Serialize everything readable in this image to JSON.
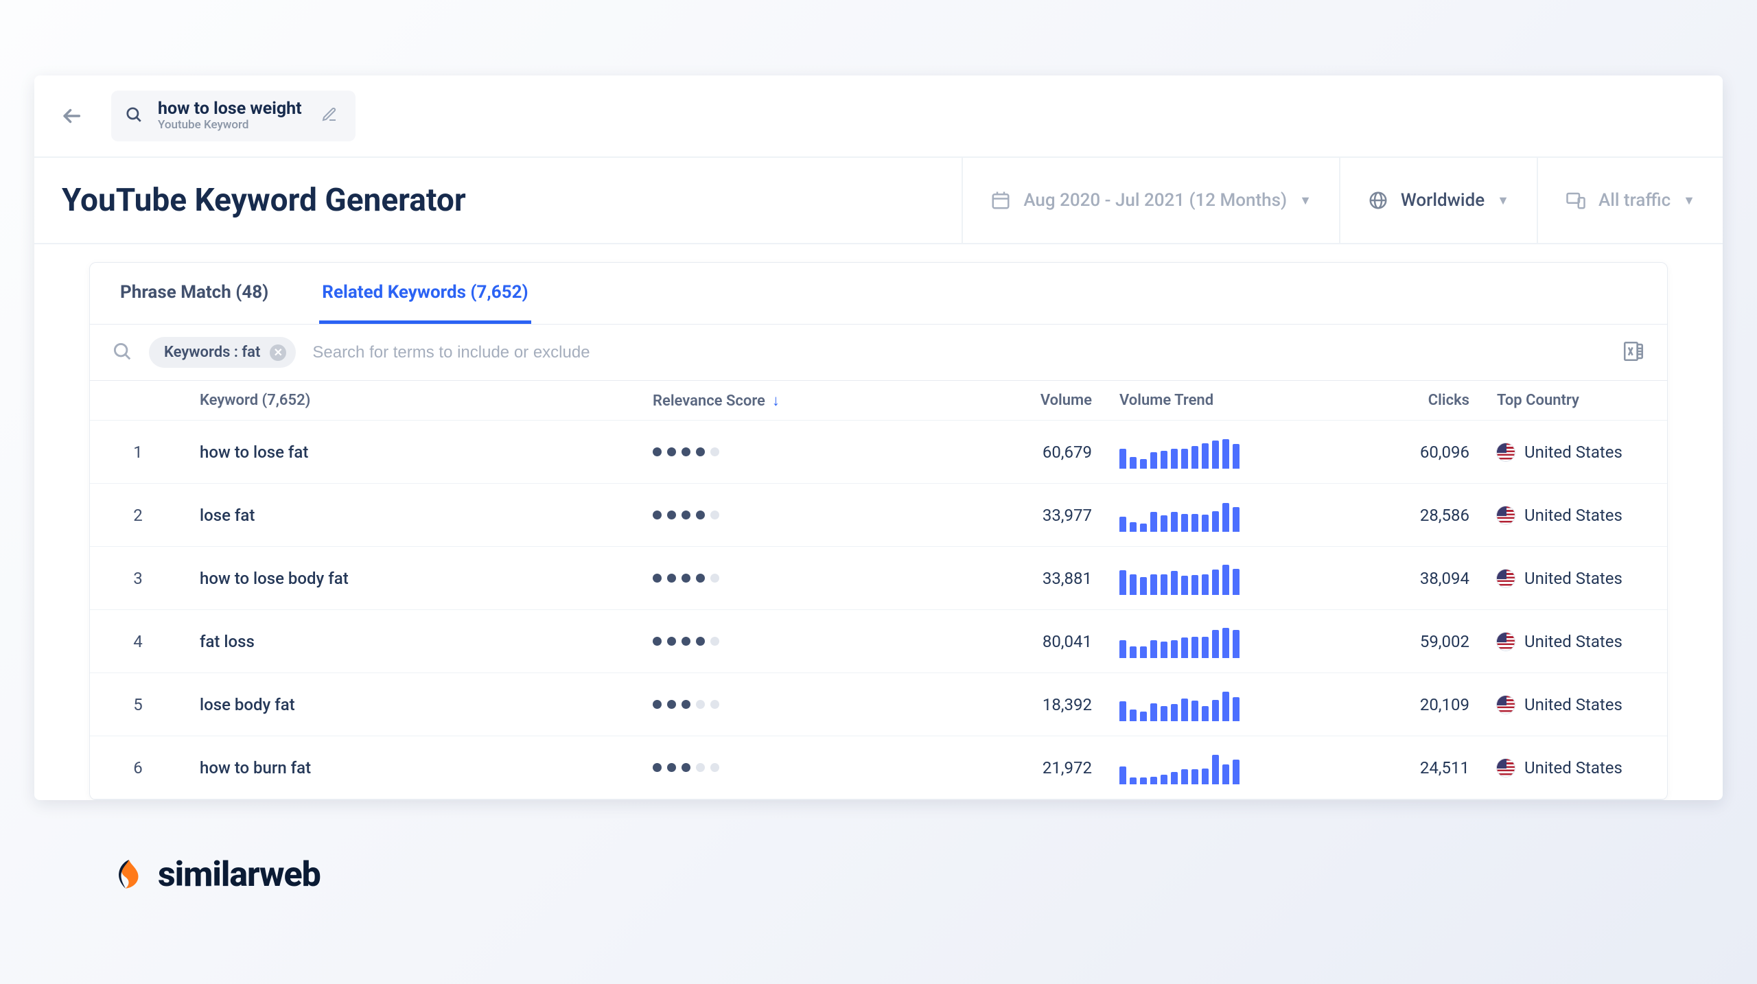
{
  "topbar": {
    "query": "how to lose weight",
    "query_type": "Youtube Keyword"
  },
  "page_title": "YouTube Keyword Generator",
  "filters": {
    "date_range": "Aug 2020 - Jul 2021 (12 Months)",
    "region": "Worldwide",
    "traffic": "All traffic"
  },
  "tabs": {
    "phrase_match": "Phrase Match (48)",
    "related": "Related Keywords (7,652)"
  },
  "filter_chip": "Keywords : fat",
  "search_placeholder": "Search for terms to include or exclude",
  "columns": {
    "keyword": "Keyword (7,652)",
    "relevance": "Relevance Score",
    "volume": "Volume",
    "trend": "Volume Trend",
    "clicks": "Clicks",
    "country": "Top Country"
  },
  "rows": [
    {
      "idx": "1",
      "keyword": "how to lose fat",
      "relevance": 4,
      "volume": "60,679",
      "trend": [
        60,
        35,
        30,
        50,
        55,
        60,
        60,
        68,
        78,
        85,
        90,
        75
      ],
      "clicks": "60,096",
      "country": "United States"
    },
    {
      "idx": "2",
      "keyword": "lose fat",
      "relevance": 4,
      "volume": "33,977",
      "trend": [
        45,
        30,
        25,
        60,
        50,
        60,
        55,
        55,
        52,
        62,
        88,
        75
      ],
      "clicks": "28,586",
      "country": "United States"
    },
    {
      "idx": "3",
      "keyword": "how to lose body fat",
      "relevance": 4,
      "volume": "33,881",
      "trend": [
        75,
        62,
        55,
        62,
        62,
        72,
        58,
        60,
        62,
        78,
        92,
        80
      ],
      "clicks": "38,094",
      "country": "United States"
    },
    {
      "idx": "4",
      "keyword": "fat loss",
      "relevance": 4,
      "volume": "80,041",
      "trend": [
        55,
        35,
        36,
        55,
        50,
        55,
        62,
        65,
        65,
        85,
        92,
        85
      ],
      "clicks": "59,002",
      "country": "United States"
    },
    {
      "idx": "5",
      "keyword": "lose body fat",
      "relevance": 3,
      "volume": "18,392",
      "trend": [
        60,
        35,
        30,
        55,
        45,
        52,
        68,
        62,
        45,
        65,
        90,
        72
      ],
      "clicks": "20,109",
      "country": "United States"
    },
    {
      "idx": "6",
      "keyword": "how to burn fat",
      "relevance": 3,
      "volume": "21,972",
      "trend": [
        55,
        20,
        20,
        22,
        30,
        38,
        45,
        45,
        48,
        90,
        60,
        75
      ],
      "clicks": "24,511",
      "country": "United States"
    }
  ],
  "brand": "similarweb"
}
